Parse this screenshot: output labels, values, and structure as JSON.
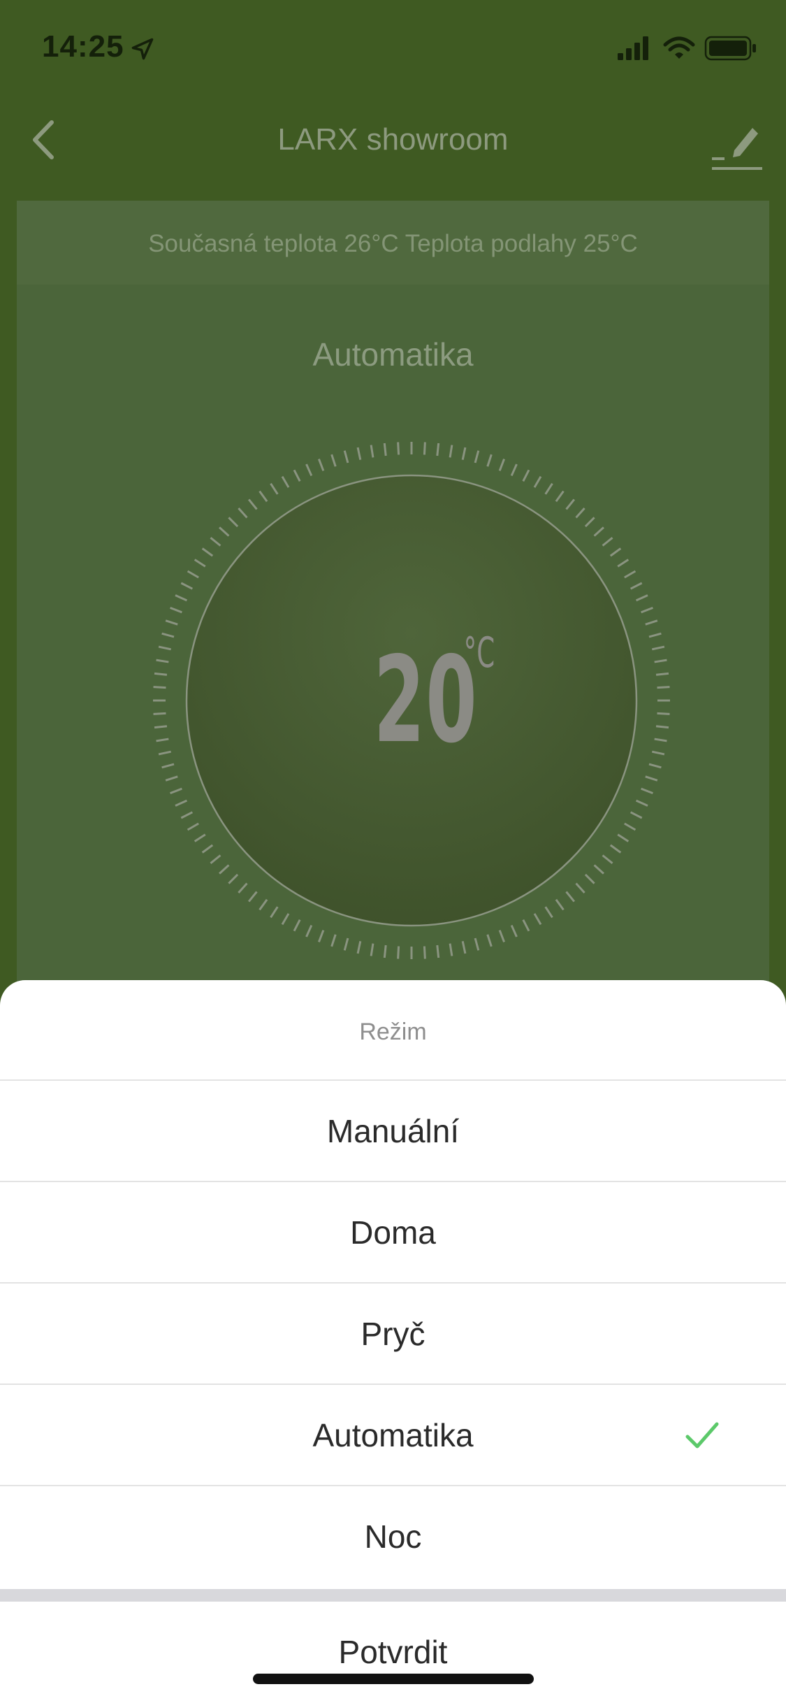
{
  "status_bar": {
    "time": "14:25"
  },
  "nav": {
    "title": "LARX showroom"
  },
  "card": {
    "current_temperature_text": "Současná teplota 26°C Teplota podlahy 25°C",
    "mode_label": "Automatika",
    "set_temperature": "20",
    "set_temperature_unit": "°C"
  },
  "sheet": {
    "title": "Režim",
    "options": [
      {
        "label": "Manuální",
        "selected": false
      },
      {
        "label": "Doma",
        "selected": false
      },
      {
        "label": "Pryč",
        "selected": false
      },
      {
        "label": "Automatika",
        "selected": true
      },
      {
        "label": "Noc",
        "selected": false
      }
    ],
    "confirm_label": "Potvrdit"
  },
  "colors": {
    "header_green": "#3f5a22",
    "card_green": "#4b653a",
    "check_green": "#5cc96a"
  },
  "icons": {
    "back": "chevron-left-icon",
    "edit": "pencil-icon",
    "location": "location-arrow-icon",
    "check": "checkmark-icon"
  }
}
